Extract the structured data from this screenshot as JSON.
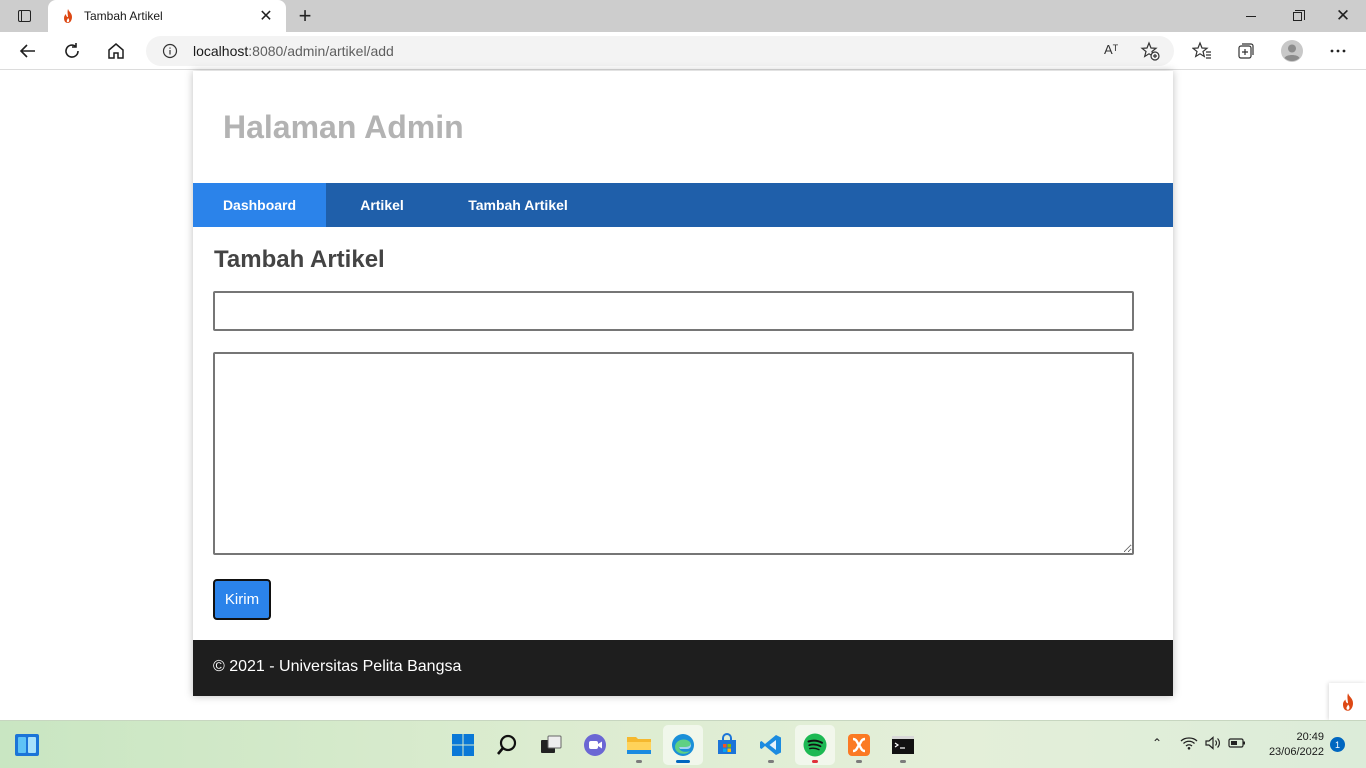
{
  "browser": {
    "tab_title": "Tambah Artikel",
    "new_tab_label": "+",
    "close_tab_label": "✕",
    "address_host": "localhost",
    "address_path": ":8080/admin/artikel/add",
    "read_aloud_label": "Aᵀ"
  },
  "page": {
    "site_title": "Halaman Admin",
    "nav": [
      {
        "label": "Dashboard",
        "active": true
      },
      {
        "label": "Artikel",
        "active": false
      },
      {
        "label": "Tambah Artikel",
        "active": false
      }
    ],
    "content_title": "Tambah Artikel",
    "form": {
      "title_value": "",
      "body_value": "",
      "submit_label": "Kirim"
    },
    "footer_text": "© 2021 - Universitas Pelita Bangsa"
  },
  "colors": {
    "nav_bg": "#1f5faa",
    "nav_active": "#2b83ea",
    "button_bg": "#2b83ea",
    "footer_bg": "#1e1e1e",
    "site_title": "#b3b3b3"
  },
  "taskbar": {
    "apps": [
      "start-icon",
      "search-icon",
      "task-view-icon",
      "chat-icon",
      "file-explorer-icon",
      "edge-icon",
      "store-icon",
      "vscode-icon",
      "spotify-icon",
      "xampp-icon",
      "terminal-icon"
    ],
    "clock_time": "20:49",
    "clock_date": "23/06/2022",
    "notification_count": "1"
  }
}
